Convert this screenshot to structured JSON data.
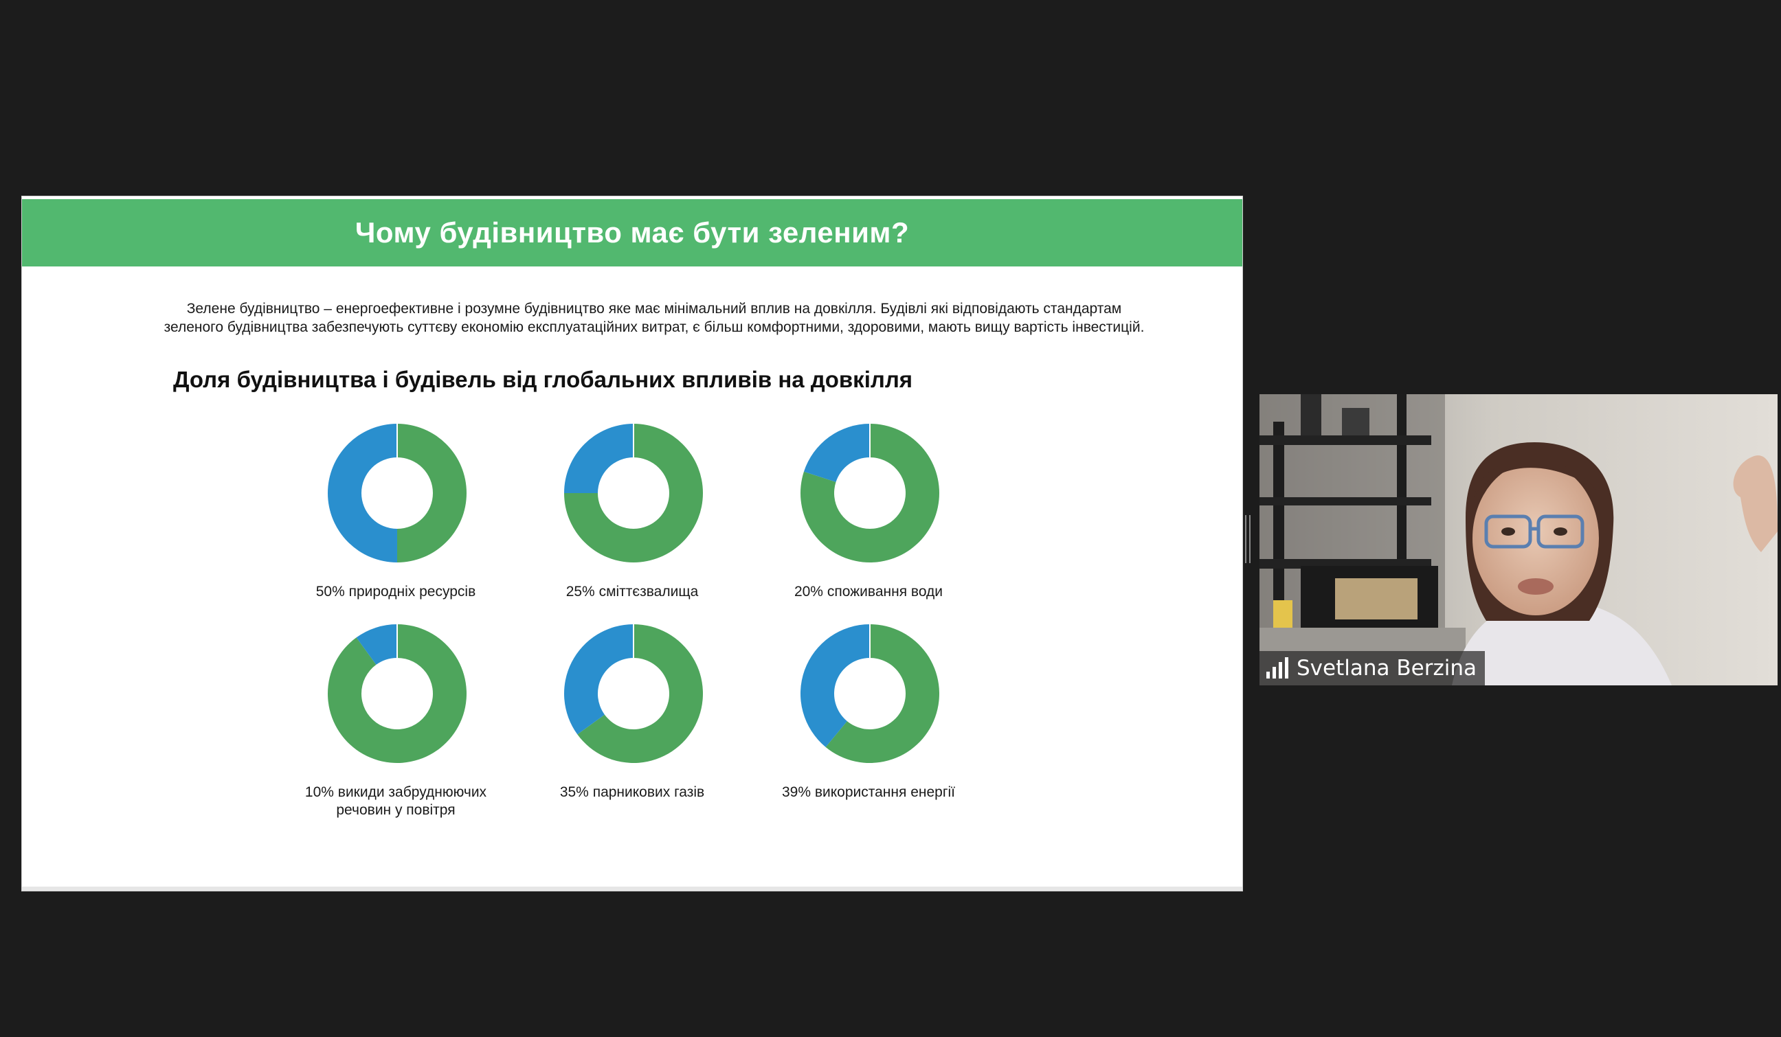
{
  "slide": {
    "title": "Чому будівництво має бути зеленим?",
    "intro_line1": "Зелене будівництво – енергоефективне і  розумне будівництво яке має мінімальний вплив на довкілля.  Будівлі  які відповідають стандартам",
    "intro_line2": "зеленого будівництва забезпечують суттєву економію експлуатаційних витрат, є більш комфортними, здоровими, мають вищу вартість інвестицій."
  },
  "chart_data": {
    "type": "pie",
    "title": "Доля будівництва і будівель від глобальних впливів на довкілля",
    "colors": {
      "share": "#2a8fce",
      "rest": "#4ea55c"
    },
    "slices": [
      {
        "label": "50% природніх ресурсів",
        "value": 50
      },
      {
        "label": "25% сміттєзвалища",
        "value": 25
      },
      {
        "label": "20% споживання води",
        "value": 20
      },
      {
        "label": "10% викиди забруднюючих речовин у повітря",
        "value": 10
      },
      {
        "label": "35% парникових газів",
        "value": 35
      },
      {
        "label": "39% використання енергії",
        "value": 39
      }
    ]
  },
  "labels": {
    "d0": "50% природніх ресурсів",
    "d1": "25% сміттєзвалища",
    "d2": "20% споживання води",
    "d3_line1": "10% викиди забруднюючих",
    "d3_line2": "речовин у повітря",
    "d4": "35% парникових газів",
    "d5": "39% використання енергії"
  },
  "participant": {
    "name": "Svetlana Berzina",
    "signal_icon": "signal-bars-icon"
  }
}
